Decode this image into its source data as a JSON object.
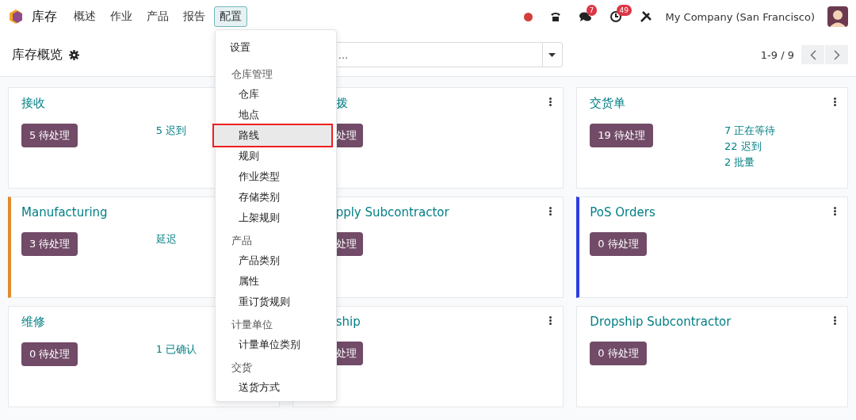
{
  "navbar": {
    "app_name": "库存",
    "menus": [
      {
        "label": "概述",
        "selected": false
      },
      {
        "label": "作业",
        "selected": false
      },
      {
        "label": "产品",
        "selected": false
      },
      {
        "label": "报告",
        "selected": false
      },
      {
        "label": "配置",
        "selected": true
      }
    ],
    "chat_count": "7",
    "activity_count": "49",
    "company": "My Company (San Francisco)"
  },
  "control_panel": {
    "title": "库存概览",
    "search": {
      "placeholder": "..."
    },
    "pager": "1-9 / 9"
  },
  "cards": [
    {
      "kind": "full",
      "title": "接收",
      "badge": "5 待处理",
      "stats": [
        "5 迟到"
      ]
    },
    {
      "kind": "covered",
      "title": "拨",
      "badge": "处理"
    },
    {
      "kind": "full",
      "title": "交货单",
      "badge": "19 待处理",
      "stats": [
        "7 正在等待",
        "22 迟到",
        "2 批量"
      ]
    },
    {
      "kind": "full",
      "title": "Manufacturing",
      "badge": "3 待处理",
      "stats": [
        "延迟"
      ],
      "color": "#e08a2e"
    },
    {
      "kind": "covered",
      "title": "pply Subcontractor",
      "badge": "处理"
    },
    {
      "kind": "full",
      "title": "PoS Orders",
      "badge": "0 待处理",
      "color": "#2d3ee0"
    },
    {
      "kind": "full",
      "title": "维修",
      "badge": "0 待处理",
      "stats": [
        "1 已确认"
      ]
    },
    {
      "kind": "covered",
      "title": "ship",
      "badge": "处理"
    },
    {
      "kind": "full",
      "title": "Dropship Subcontractor",
      "badge": "0 待处理"
    }
  ],
  "menu": [
    {
      "kind": "item",
      "label": "设置",
      "selected": false
    },
    {
      "kind": "header",
      "label": "仓库管理"
    },
    {
      "kind": "item",
      "label": "仓库",
      "selected": false
    },
    {
      "kind": "item",
      "label": "地点",
      "selected": false
    },
    {
      "kind": "item",
      "label": "路线",
      "selected": true
    },
    {
      "kind": "item",
      "label": "规则",
      "selected": false
    },
    {
      "kind": "item",
      "label": "作业类型",
      "selected": false
    },
    {
      "kind": "item",
      "label": "存储类别",
      "selected": false
    },
    {
      "kind": "item",
      "label": "上架规则",
      "selected": false
    },
    {
      "kind": "header",
      "label": "产品"
    },
    {
      "kind": "item",
      "label": "产品类别",
      "selected": false
    },
    {
      "kind": "item",
      "label": "属性",
      "selected": false
    },
    {
      "kind": "item",
      "label": "重订货规则",
      "selected": false
    },
    {
      "kind": "header",
      "label": "计量单位"
    },
    {
      "kind": "item",
      "label": "计量单位类别",
      "selected": false
    },
    {
      "kind": "header",
      "label": "交货"
    },
    {
      "kind": "item",
      "label": "送货方式",
      "selected": false
    }
  ]
}
